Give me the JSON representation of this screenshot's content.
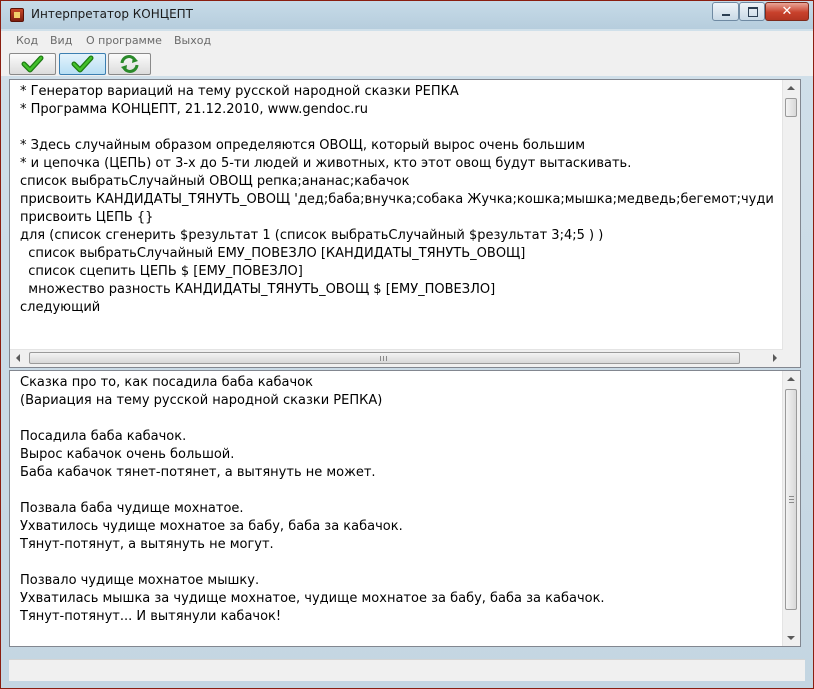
{
  "window": {
    "title": "Интерпретатор КОНЦЕПТ"
  },
  "menu": {
    "items": [
      "Код",
      "Вид",
      "О программе",
      "Выход"
    ]
  },
  "toolbar": {
    "buttons": [
      {
        "icon": "green-check-icon"
      },
      {
        "icon": "blue-check-icon"
      },
      {
        "icon": "refresh-icon"
      }
    ]
  },
  "code_editor": {
    "lines": [
      "* Генератор вариаций на тему русской народной сказки РЕПКА",
      "* Программа КОНЦЕПТ, 21.12.2010, www.gendoc.ru",
      "",
      "* Здесь случайным образом определяются ОВОЩ, который вырос очень большим",
      "* и цепочка (ЦЕПЬ) от 3-х до 5-ти людей и животных, кто этот овощ будут вытаскивать.",
      "список выбратьСлучайный ОВОЩ репка;ананас;кабачок",
      "присвоить КАНДИДАТЫ_ТЯНУТЬ_ОВОЩ 'дед;баба;внучка;собака Жучка;кошка;мышка;медведь;бегемот;чуди",
      "присвоить ЦЕПЬ {}",
      "для (список сгенерить $результат 1 (список выбратьСлучайный $результат 3;4;5 ) )",
      "  список выбратьСлучайный ЕМУ_ПОВЕЗЛО [КАНДИДАТЫ_ТЯНУТЬ_ОВОЩ]",
      "  список сцепить ЦЕПЬ $ [ЕМУ_ПОВЕЗЛО]",
      "  множество разность КАНДИДАТЫ_ТЯНУТЬ_ОВОЩ $ [ЕМУ_ПОВЕЗЛО]",
      "следующий"
    ]
  },
  "output": {
    "lines": [
      "Сказка про то, как посадила баба кабачок",
      "(Вариация на тему русской народной сказки РЕПКА)",
      "",
      "Посадила баба кабачок.",
      "Вырос кабачок очень большой.",
      "Баба кабачок тянет-потянет, а вытянуть не может.",
      "",
      "Позвала баба чудище мохнатое.",
      "Ухватилось чудище мохнатое за бабу, баба за кабачок.",
      "Тянут-потянут, а вытянуть не могут.",
      "",
      "Позвало чудище мохнатое мышку.",
      "Ухватилась мышка за чудище мохнатое, чудище мохнатое за бабу, баба за кабачок.",
      "Тянут-потянут... И вытянули кабачок!"
    ]
  },
  "colors": {
    "window_border": "#8a1e10",
    "check_green": "#2e9a1f",
    "refresh_green": "#2b8a2b"
  }
}
